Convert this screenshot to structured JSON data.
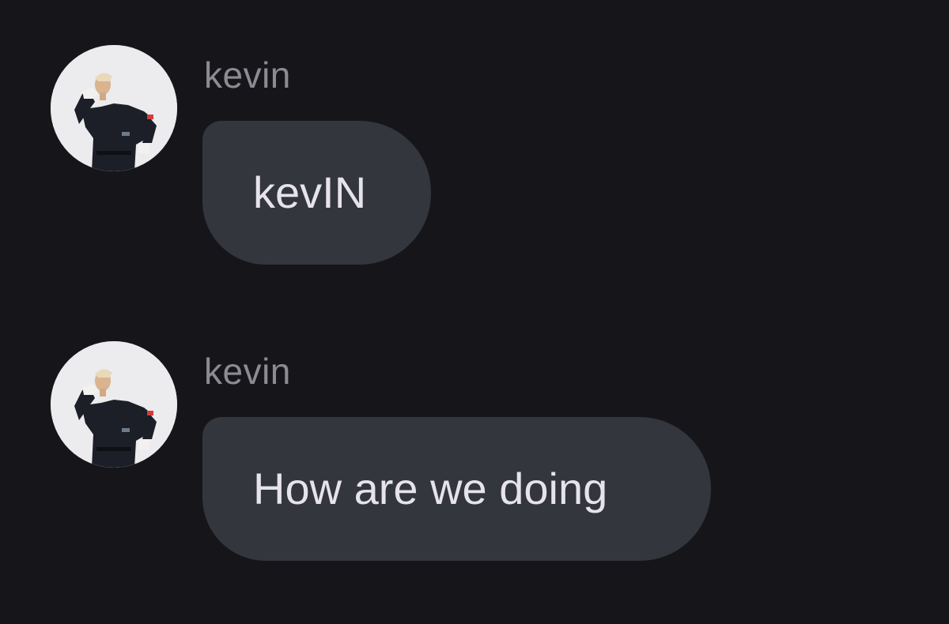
{
  "messages": [
    {
      "sender": "kevin",
      "text": "kevIN"
    },
    {
      "sender": "kevin",
      "text": "How are we doing"
    }
  ],
  "colors": {
    "background": "#16161a",
    "bubble": "#34363d",
    "sender_text": "#8d8b92",
    "message_text": "#e6e3ea"
  },
  "icons": {
    "avatar": "profile-photo-avatar"
  }
}
